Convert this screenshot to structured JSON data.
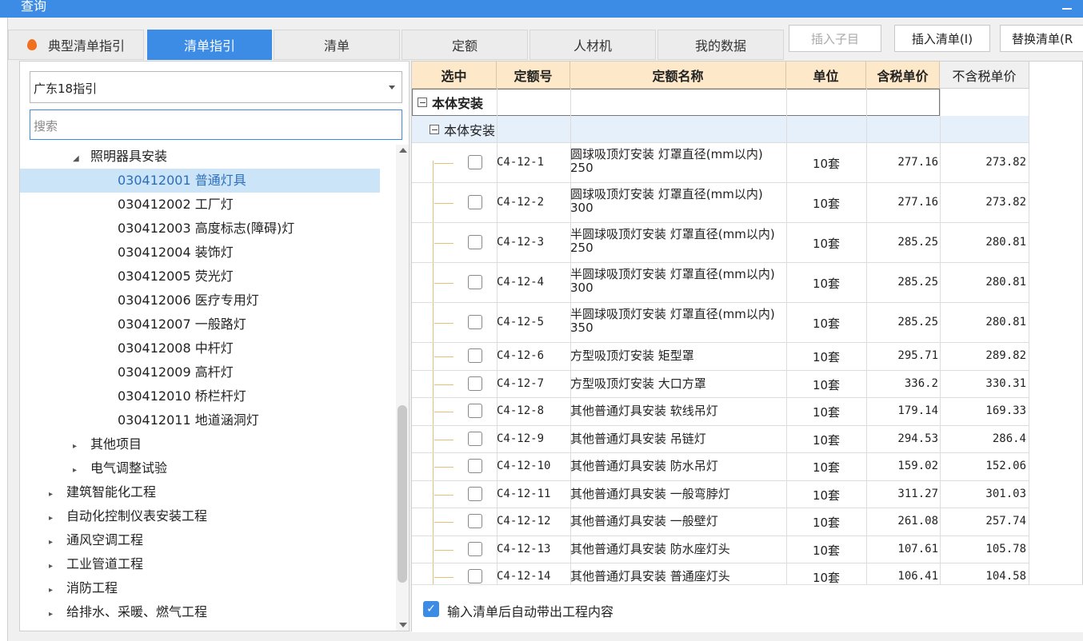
{
  "window": {
    "title": "查询"
  },
  "tabs": [
    {
      "label": "典型清单指引"
    },
    {
      "label": "清单指引"
    },
    {
      "label": "清单"
    },
    {
      "label": "定额"
    },
    {
      "label": "人材机"
    },
    {
      "label": "我的数据"
    }
  ],
  "toolbar": {
    "insert_child": "插入子目",
    "insert_list": "插入清单(I)",
    "replace_list": "替换清单(R"
  },
  "left": {
    "dropdown_value": "广东18指引",
    "search_placeholder": "搜索",
    "tree": [
      {
        "label": "照明器具安装",
        "level": 2,
        "expanded": true
      },
      {
        "label": "030412001  普通灯具",
        "level": 3,
        "selected": true
      },
      {
        "label": "030412002  工厂灯",
        "level": 3
      },
      {
        "label": "030412003  高度标志(障碍)灯",
        "level": 3
      },
      {
        "label": "030412004  装饰灯",
        "level": 3
      },
      {
        "label": "030412005  荧光灯",
        "level": 3
      },
      {
        "label": "030412006  医疗专用灯",
        "level": 3
      },
      {
        "label": "030412007  一般路灯",
        "level": 3
      },
      {
        "label": "030412008  中杆灯",
        "level": 3
      },
      {
        "label": "030412009  高杆灯",
        "level": 3
      },
      {
        "label": "030412010  桥栏杆灯",
        "level": 3
      },
      {
        "label": "030412011  地道涵洞灯",
        "level": 3
      },
      {
        "label": "其他项目",
        "level": 2
      },
      {
        "label": "电气调整试验",
        "level": 2
      },
      {
        "label": "建筑智能化工程",
        "level": 1
      },
      {
        "label": "自动化控制仪表安装工程",
        "level": 1
      },
      {
        "label": "通风空调工程",
        "level": 1
      },
      {
        "label": "工业管道工程",
        "level": 1
      },
      {
        "label": "消防工程",
        "level": 1
      },
      {
        "label": "给排水、采暖、燃气工程",
        "level": 1
      }
    ]
  },
  "grid": {
    "headers": [
      "选中",
      "定额号",
      "定额名称",
      "单位",
      "含税单价",
      "不含税单价"
    ],
    "group1": "本体安装",
    "group2": "本体安装",
    "rows": [
      {
        "code": "C4-12-1",
        "name": "圆球吸顶灯安装 灯罩直径(mm以内) 250",
        "unit": "10套",
        "p1": "277.16",
        "p2": "273.82"
      },
      {
        "code": "C4-12-2",
        "name": "圆球吸顶灯安装 灯罩直径(mm以内) 300",
        "unit": "10套",
        "p1": "277.16",
        "p2": "273.82"
      },
      {
        "code": "C4-12-3",
        "name": "半圆球吸顶灯安装 灯罩直径(mm以内) 250",
        "unit": "10套",
        "p1": "285.25",
        "p2": "280.81"
      },
      {
        "code": "C4-12-4",
        "name": "半圆球吸顶灯安装 灯罩直径(mm以内) 300",
        "unit": "10套",
        "p1": "285.25",
        "p2": "280.81"
      },
      {
        "code": "C4-12-5",
        "name": "半圆球吸顶灯安装 灯罩直径(mm以内) 350",
        "unit": "10套",
        "p1": "285.25",
        "p2": "280.81"
      },
      {
        "code": "C4-12-6",
        "name": "方型吸顶灯安装 矩型罩",
        "unit": "10套",
        "p1": "295.71",
        "p2": "289.82"
      },
      {
        "code": "C4-12-7",
        "name": "方型吸顶灯安装 大口方罩",
        "unit": "10套",
        "p1": "336.2",
        "p2": "330.31"
      },
      {
        "code": "C4-12-8",
        "name": "其他普通灯具安装 软线吊灯",
        "unit": "10套",
        "p1": "179.14",
        "p2": "169.33"
      },
      {
        "code": "C4-12-9",
        "name": "其他普通灯具安装 吊链灯",
        "unit": "10套",
        "p1": "294.53",
        "p2": "286.4"
      },
      {
        "code": "C4-12-10",
        "name": "其他普通灯具安装 防水吊灯",
        "unit": "10套",
        "p1": "159.02",
        "p2": "152.06"
      },
      {
        "code": "C4-12-11",
        "name": "其他普通灯具安装 一般弯脖灯",
        "unit": "10套",
        "p1": "311.27",
        "p2": "301.03"
      },
      {
        "code": "C4-12-12",
        "name": "其他普通灯具安装 一般壁灯",
        "unit": "10套",
        "p1": "261.08",
        "p2": "257.74"
      },
      {
        "code": "C4-12-13",
        "name": "其他普通灯具安装 防水座灯头",
        "unit": "10套",
        "p1": "107.61",
        "p2": "105.78"
      },
      {
        "code": "C4-12-14",
        "name": "其他普通灯具安装 普通座灯头",
        "unit": "10套",
        "p1": "106.41",
        "p2": "104.58"
      }
    ]
  },
  "footer": {
    "auto_bring_label": "输入清单后自动带出工程内容",
    "auto_bring_checked": true
  }
}
